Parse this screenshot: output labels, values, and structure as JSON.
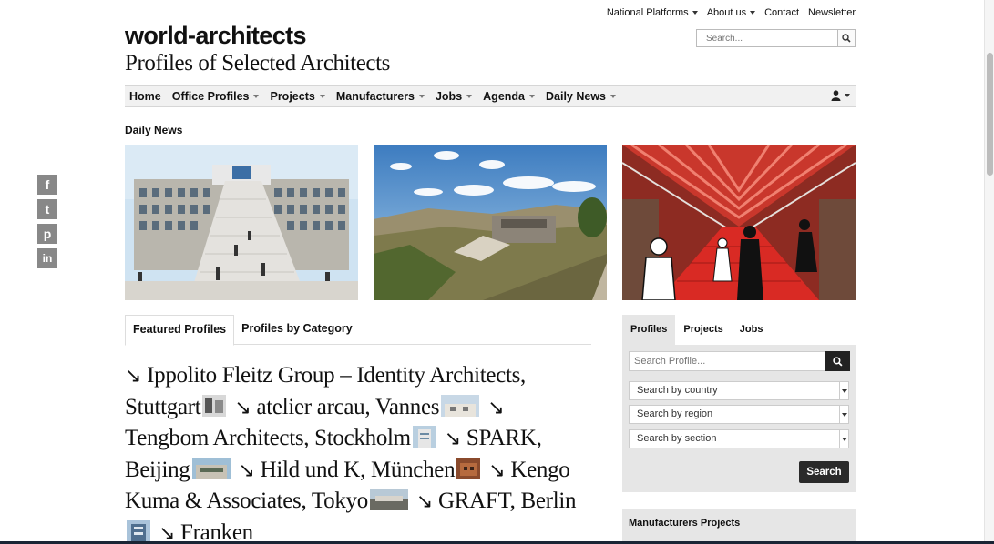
{
  "toplinks": {
    "national_platforms": "National Platforms",
    "about_us": "About us",
    "contact": "Contact",
    "newsletter": "Newsletter"
  },
  "search": {
    "placeholder": "Search..."
  },
  "logo": "world-architects",
  "tagline": "Profiles of Selected Architects",
  "nav": {
    "home": "Home",
    "office_profiles": "Office Profiles",
    "projects": "Projects",
    "manufacturers": "Manufacturers",
    "jobs": "Jobs",
    "agenda": "Agenda",
    "daily_news": "Daily News"
  },
  "section_title": "Daily News",
  "tabs": {
    "featured": "Featured Profiles",
    "by_category": "Profiles by Category"
  },
  "profiles": [
    "Ippolito Fleitz Group – Identity Architects, Stuttgart",
    "atelier arcau, Vannes",
    "Tengbom Architects, Stockholm",
    "SPARK, Beijing",
    "Hild und K, München",
    "Kengo Kuma & Associates, Tokyo",
    "GRAFT, Berlin",
    "Franken"
  ],
  "sidebar": {
    "tabs": {
      "profiles": "Profiles",
      "projects": "Projects",
      "jobs": "Jobs"
    },
    "search_placeholder": "Search Profile...",
    "country": "Search by country",
    "region": "Search by region",
    "section": "Search by section",
    "submit": "Search",
    "manufacturers_projects": "Manufacturers Projects"
  },
  "social": {
    "facebook": "f",
    "twitter": "t",
    "pinterest": "p",
    "linkedin": "in"
  }
}
